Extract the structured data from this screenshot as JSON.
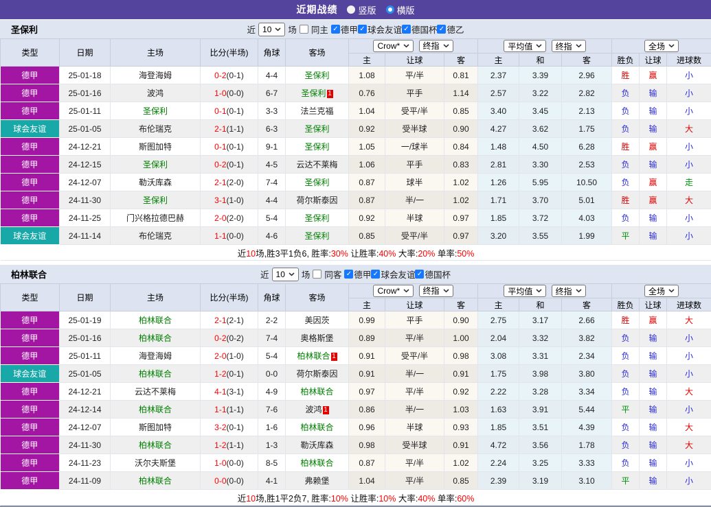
{
  "header": {
    "title": "近期战绩",
    "layout_options": [
      {
        "label": "竖版",
        "selected": false
      },
      {
        "label": "横版",
        "selected": true
      }
    ]
  },
  "colors": {
    "topbar": "#55449E",
    "league_badge": "#A316A3",
    "friendly_badge": "#18A8A8",
    "focus_team_green": "#008000",
    "score_red": "#FF0000",
    "win_red": "#DD0000",
    "lose_blue": "#2B2BD5",
    "draw_green": "#00940C"
  },
  "table_head": {
    "static_cols": [
      "类型",
      "日期",
      "主场",
      "比分(半场)",
      "角球",
      "客场"
    ],
    "odds_provider_dropdown": "Crow*",
    "odds_index_dropdown": "终指",
    "avg_dropdown": "平均值",
    "avg_index_dropdown": "终指",
    "scope_dropdown": "全场",
    "odds_sub": [
      "主",
      "让球",
      "客"
    ],
    "avg_sub": [
      "主",
      "和",
      "客"
    ],
    "result_sub": [
      "胜负",
      "让球",
      "进球数"
    ]
  },
  "sections": [
    {
      "team": "圣保利",
      "filter": {
        "near_label": "近",
        "count": "10",
        "games_label": "场",
        "same": {
          "label": "同主",
          "checked": false
        },
        "leagues": [
          {
            "label": "德甲",
            "checked": true
          },
          {
            "label": "球会友谊",
            "checked": true
          },
          {
            "label": "德国杯",
            "checked": true
          },
          {
            "label": "德乙",
            "checked": true
          }
        ]
      },
      "rows": [
        {
          "type": "德甲",
          "kind": "league",
          "date": "25-01-18",
          "home": "海登海姆",
          "home_focus": false,
          "home_card": "",
          "score": "0-2",
          "half": "(0-1)",
          "corners": "4-4",
          "away": "圣保利",
          "away_focus": true,
          "away_card": "",
          "odds": [
            "1.08",
            "平/半",
            "0.81"
          ],
          "avg": [
            "2.37",
            "3.39",
            "2.96"
          ],
          "result": [
            "胜",
            "赢",
            "小"
          ]
        },
        {
          "type": "德甲",
          "kind": "league",
          "date": "25-01-16",
          "home": "波鸿",
          "home_focus": false,
          "home_card": "",
          "score": "1-0",
          "half": "(0-0)",
          "corners": "6-7",
          "away": "圣保利",
          "away_focus": true,
          "away_card": "1",
          "odds": [
            "0.76",
            "平手",
            "1.14"
          ],
          "avg": [
            "2.57",
            "3.22",
            "2.82"
          ],
          "result": [
            "负",
            "输",
            "小"
          ]
        },
        {
          "type": "德甲",
          "kind": "league",
          "date": "25-01-11",
          "home": "圣保利",
          "home_focus": true,
          "home_card": "",
          "score": "0-1",
          "half": "(0-1)",
          "corners": "3-3",
          "away": "法兰克福",
          "away_focus": false,
          "away_card": "",
          "odds": [
            "1.04",
            "受平/半",
            "0.85"
          ],
          "avg": [
            "3.40",
            "3.45",
            "2.13"
          ],
          "result": [
            "负",
            "输",
            "小"
          ]
        },
        {
          "type": "球会友谊",
          "kind": "friendly",
          "date": "25-01-05",
          "home": "布伦瑞克",
          "home_focus": false,
          "home_card": "",
          "score": "2-1",
          "half": "(1-1)",
          "corners": "6-3",
          "away": "圣保利",
          "away_focus": true,
          "away_card": "",
          "odds": [
            "0.92",
            "受半球",
            "0.90"
          ],
          "avg": [
            "4.27",
            "3.62",
            "1.75"
          ],
          "result": [
            "负",
            "输",
            "大"
          ]
        },
        {
          "type": "德甲",
          "kind": "league",
          "date": "24-12-21",
          "home": "斯图加特",
          "home_focus": false,
          "home_card": "",
          "score": "0-1",
          "half": "(0-1)",
          "corners": "9-1",
          "away": "圣保利",
          "away_focus": true,
          "away_card": "",
          "odds": [
            "1.05",
            "一/球半",
            "0.84"
          ],
          "avg": [
            "1.48",
            "4.50",
            "6.28"
          ],
          "result": [
            "胜",
            "赢",
            "小"
          ]
        },
        {
          "type": "德甲",
          "kind": "league",
          "date": "24-12-15",
          "home": "圣保利",
          "home_focus": true,
          "home_card": "",
          "score": "0-2",
          "half": "(0-1)",
          "corners": "4-5",
          "away": "云达不莱梅",
          "away_focus": false,
          "away_card": "",
          "odds": [
            "1.06",
            "平手",
            "0.83"
          ],
          "avg": [
            "2.81",
            "3.30",
            "2.53"
          ],
          "result": [
            "负",
            "输",
            "小"
          ]
        },
        {
          "type": "德甲",
          "kind": "league",
          "date": "24-12-07",
          "home": "勒沃库森",
          "home_focus": false,
          "home_card": "",
          "score": "2-1",
          "half": "(2-0)",
          "corners": "7-4",
          "away": "圣保利",
          "away_focus": true,
          "away_card": "",
          "odds": [
            "0.87",
            "球半",
            "1.02"
          ],
          "avg": [
            "1.26",
            "5.95",
            "10.50"
          ],
          "result": [
            "负",
            "赢",
            "走"
          ]
        },
        {
          "type": "德甲",
          "kind": "league",
          "date": "24-11-30",
          "home": "圣保利",
          "home_focus": true,
          "home_card": "",
          "score": "3-1",
          "half": "(1-0)",
          "corners": "4-4",
          "away": "荷尔斯泰因",
          "away_focus": false,
          "away_card": "",
          "odds": [
            "0.87",
            "半/一",
            "1.02"
          ],
          "avg": [
            "1.71",
            "3.70",
            "5.01"
          ],
          "result": [
            "胜",
            "赢",
            "大"
          ]
        },
        {
          "type": "德甲",
          "kind": "league",
          "date": "24-11-25",
          "home": "门兴格拉德巴赫",
          "home_focus": false,
          "home_card": "",
          "score": "2-0",
          "half": "(2-0)",
          "corners": "5-4",
          "away": "圣保利",
          "away_focus": true,
          "away_card": "",
          "odds": [
            "0.92",
            "半球",
            "0.97"
          ],
          "avg": [
            "1.85",
            "3.72",
            "4.03"
          ],
          "result": [
            "负",
            "输",
            "小"
          ]
        },
        {
          "type": "球会友谊",
          "kind": "friendly",
          "date": "24-11-14",
          "home": "布伦瑞克",
          "home_focus": false,
          "home_card": "",
          "score": "1-1",
          "half": "(0-0)",
          "corners": "4-6",
          "away": "圣保利",
          "away_focus": true,
          "away_card": "",
          "odds": [
            "0.85",
            "受平/半",
            "0.97"
          ],
          "avg": [
            "3.20",
            "3.55",
            "1.99"
          ],
          "result": [
            "平",
            "输",
            "小"
          ]
        }
      ],
      "summary": [
        {
          "t": "近"
        },
        {
          "t": "10",
          "red": true
        },
        {
          "t": "场,胜3平1负6, 胜率:"
        },
        {
          "t": "30%",
          "red": true
        },
        {
          "t": " 让胜率:"
        },
        {
          "t": "40%",
          "red": true
        },
        {
          "t": " 大率:"
        },
        {
          "t": "20%",
          "red": true
        },
        {
          "t": " 单率:"
        },
        {
          "t": "50%",
          "red": true
        }
      ]
    },
    {
      "team": "柏林联合",
      "filter": {
        "near_label": "近",
        "count": "10",
        "games_label": "场",
        "same": {
          "label": "同客",
          "checked": false
        },
        "leagues": [
          {
            "label": "德甲",
            "checked": true
          },
          {
            "label": "球会友谊",
            "checked": true
          },
          {
            "label": "德国杯",
            "checked": true
          }
        ]
      },
      "rows": [
        {
          "type": "德甲",
          "kind": "league",
          "date": "25-01-19",
          "home": "柏林联合",
          "home_focus": true,
          "home_card": "",
          "score": "2-1",
          "half": "(2-1)",
          "corners": "2-2",
          "away": "美因茨",
          "away_focus": false,
          "away_card": "",
          "odds": [
            "0.99",
            "平手",
            "0.90"
          ],
          "avg": [
            "2.75",
            "3.17",
            "2.66"
          ],
          "result": [
            "胜",
            "赢",
            "大"
          ]
        },
        {
          "type": "德甲",
          "kind": "league",
          "date": "25-01-16",
          "home": "柏林联合",
          "home_focus": true,
          "home_card": "",
          "score": "0-2",
          "half": "(0-2)",
          "corners": "7-4",
          "away": "奥格斯堡",
          "away_focus": false,
          "away_card": "",
          "odds": [
            "0.89",
            "平/半",
            "1.00"
          ],
          "avg": [
            "2.04",
            "3.32",
            "3.82"
          ],
          "result": [
            "负",
            "输",
            "小"
          ]
        },
        {
          "type": "德甲",
          "kind": "league",
          "date": "25-01-11",
          "home": "海登海姆",
          "home_focus": false,
          "home_card": "",
          "score": "2-0",
          "half": "(1-0)",
          "corners": "5-4",
          "away": "柏林联合",
          "away_focus": true,
          "away_card": "1",
          "odds": [
            "0.91",
            "受平/半",
            "0.98"
          ],
          "avg": [
            "3.08",
            "3.31",
            "2.34"
          ],
          "result": [
            "负",
            "输",
            "小"
          ]
        },
        {
          "type": "球会友谊",
          "kind": "friendly",
          "date": "25-01-05",
          "home": "柏林联合",
          "home_focus": true,
          "home_card": "",
          "score": "1-2",
          "half": "(0-1)",
          "corners": "0-0",
          "away": "荷尔斯泰因",
          "away_focus": false,
          "away_card": "",
          "odds": [
            "0.91",
            "半/一",
            "0.91"
          ],
          "avg": [
            "1.75",
            "3.98",
            "3.80"
          ],
          "result": [
            "负",
            "输",
            "小"
          ]
        },
        {
          "type": "德甲",
          "kind": "league",
          "date": "24-12-21",
          "home": "云达不莱梅",
          "home_focus": false,
          "home_card": "",
          "score": "4-1",
          "half": "(3-1)",
          "corners": "4-9",
          "away": "柏林联合",
          "away_focus": true,
          "away_card": "",
          "odds": [
            "0.97",
            "平/半",
            "0.92"
          ],
          "avg": [
            "2.22",
            "3.28",
            "3.34"
          ],
          "result": [
            "负",
            "输",
            "大"
          ]
        },
        {
          "type": "德甲",
          "kind": "league",
          "date": "24-12-14",
          "home": "柏林联合",
          "home_focus": true,
          "home_card": "",
          "score": "1-1",
          "half": "(1-1)",
          "corners": "7-6",
          "away": "波鸿",
          "away_focus": false,
          "away_card": "1",
          "odds": [
            "0.86",
            "半/一",
            "1.03"
          ],
          "avg": [
            "1.63",
            "3.91",
            "5.44"
          ],
          "result": [
            "平",
            "输",
            "小"
          ]
        },
        {
          "type": "德甲",
          "kind": "league",
          "date": "24-12-07",
          "home": "斯图加特",
          "home_focus": false,
          "home_card": "",
          "score": "3-2",
          "half": "(0-1)",
          "corners": "1-6",
          "away": "柏林联合",
          "away_focus": true,
          "away_card": "",
          "odds": [
            "0.96",
            "半球",
            "0.93"
          ],
          "avg": [
            "1.85",
            "3.51",
            "4.39"
          ],
          "result": [
            "负",
            "输",
            "大"
          ]
        },
        {
          "type": "德甲",
          "kind": "league",
          "date": "24-11-30",
          "home": "柏林联合",
          "home_focus": true,
          "home_card": "",
          "score": "1-2",
          "half": "(1-1)",
          "corners": "1-3",
          "away": "勒沃库森",
          "away_focus": false,
          "away_card": "",
          "odds": [
            "0.98",
            "受半球",
            "0.91"
          ],
          "avg": [
            "4.72",
            "3.56",
            "1.78"
          ],
          "result": [
            "负",
            "输",
            "大"
          ]
        },
        {
          "type": "德甲",
          "kind": "league",
          "date": "24-11-23",
          "home": "沃尔夫斯堡",
          "home_focus": false,
          "home_card": "",
          "score": "1-0",
          "half": "(0-0)",
          "corners": "8-5",
          "away": "柏林联合",
          "away_focus": true,
          "away_card": "",
          "odds": [
            "0.87",
            "平/半",
            "1.02"
          ],
          "avg": [
            "2.24",
            "3.25",
            "3.33"
          ],
          "result": [
            "负",
            "输",
            "小"
          ]
        },
        {
          "type": "德甲",
          "kind": "league",
          "date": "24-11-09",
          "home": "柏林联合",
          "home_focus": true,
          "home_card": "",
          "score": "0-0",
          "half": "(0-0)",
          "corners": "4-1",
          "away": "弗赖堡",
          "away_focus": false,
          "away_card": "",
          "odds": [
            "1.04",
            "平/半",
            "0.85"
          ],
          "avg": [
            "2.39",
            "3.19",
            "3.10"
          ],
          "result": [
            "平",
            "输",
            "小"
          ]
        }
      ],
      "summary": [
        {
          "t": "近"
        },
        {
          "t": "10",
          "red": true
        },
        {
          "t": "场,胜1平2负7, 胜率:"
        },
        {
          "t": "10%",
          "red": true
        },
        {
          "t": " 让胜率:"
        },
        {
          "t": "10%",
          "red": true
        },
        {
          "t": " 大率:"
        },
        {
          "t": "40%",
          "red": true
        },
        {
          "t": " 单率:"
        },
        {
          "t": "60%",
          "red": true
        }
      ]
    }
  ]
}
